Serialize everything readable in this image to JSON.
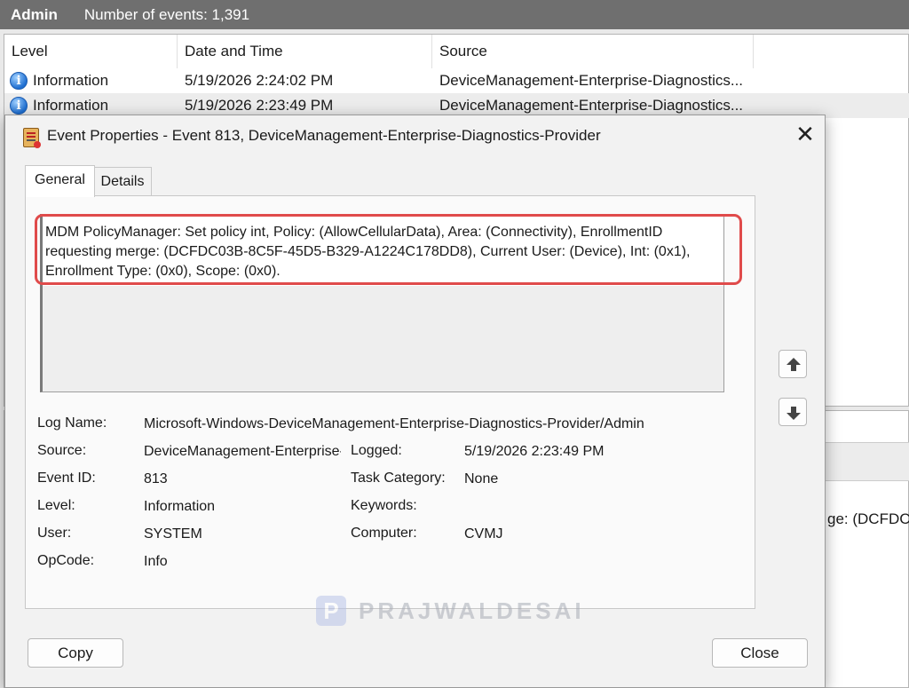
{
  "background": {
    "header": {
      "title": "Admin",
      "count": "Number of events: 1,391"
    },
    "columns": [
      "Level",
      "Date and Time",
      "Source"
    ],
    "rows": [
      {
        "level": "Information",
        "datetime": "5/19/2026 2:24:02 PM",
        "source": "DeviceManagement-Enterprise-Diagnostics..."
      },
      {
        "level": "Information",
        "datetime": "5/19/2026 2:23:49 PM",
        "source": "DeviceManagement-Enterprise-Diagnostics..."
      }
    ],
    "peek_text": "ge: (DCFDC0"
  },
  "dialog": {
    "title": "Event Properties - Event 813, DeviceManagement-Enterprise-Diagnostics-Provider",
    "tabs": {
      "general": "General",
      "details": "Details"
    },
    "description": {
      "line1": "MDM PolicyManager: Set policy int, Policy: (AllowCellularData), Area: (Connectivity), EnrollmentID",
      "line2": "requesting merge: (DCFDC03B-8C5F-45D5-B329-A1224C178DD8), Current User: (Device), Int: (0x1),",
      "line3": "Enrollment Type: (0x0), Scope: (0x0)."
    },
    "fields": {
      "log_name_label": "Log Name:",
      "log_name": "Microsoft-Windows-DeviceManagement-Enterprise-Diagnostics-Provider/Admin",
      "source_label": "Source:",
      "source": "DeviceManagement-Enterprise-Diagnostics-Provider",
      "logged_label": "Logged:",
      "logged": "5/19/2026 2:23:49 PM",
      "event_id_label": "Event ID:",
      "event_id": "813",
      "task_category_label": "Task Category:",
      "task_category": "None",
      "level_label": "Level:",
      "level": "Information",
      "keywords_label": "Keywords:",
      "keywords": "",
      "user_label": "User:",
      "user": "SYSTEM",
      "computer_label": "Computer:",
      "computer": "CVMJ",
      "opcode_label": "OpCode:",
      "opcode": "Info"
    },
    "buttons": {
      "copy": "Copy",
      "close": "Close"
    },
    "watermark": {
      "logo": "P",
      "text": "PRAJWALDESAI"
    }
  }
}
